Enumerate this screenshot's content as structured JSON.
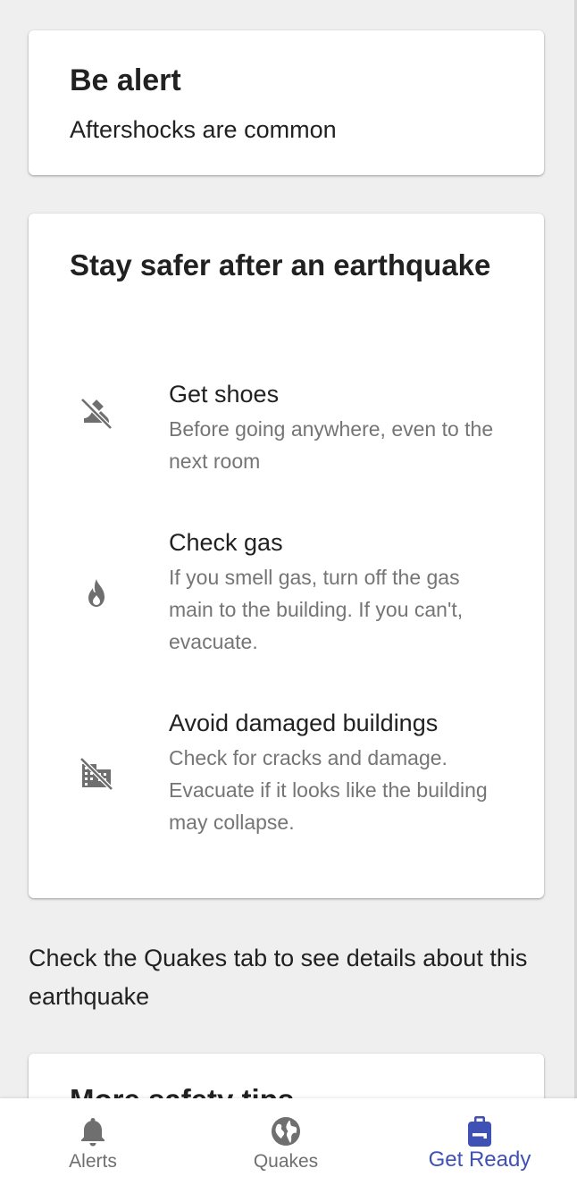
{
  "alert_card": {
    "title": "Be alert",
    "subtitle": "Aftershocks are common"
  },
  "safety_card": {
    "title": "Stay safer after an earthquake",
    "tips": [
      {
        "icon": "no-shoes-icon",
        "title": "Get shoes",
        "description": "Before going anywhere, even to the next room"
      },
      {
        "icon": "fire-icon",
        "title": "Check gas",
        "description": "If you smell gas, turn off the gas main to the building. If you can't, evacuate."
      },
      {
        "icon": "no-building-icon",
        "title": "Avoid damaged buildings",
        "description": "Check for cracks and damage. Evacuate if it looks like the building may collapse."
      }
    ]
  },
  "info_text": "Check the Quakes tab to see details about this earthquake",
  "more_card": {
    "title": "More safety tips"
  },
  "bottom_nav": {
    "items": [
      {
        "label": "Alerts",
        "icon": "bell-icon",
        "active": false
      },
      {
        "label": "Quakes",
        "icon": "globe-icon",
        "active": false
      },
      {
        "label": "Get Ready",
        "icon": "backpack-icon",
        "active": true
      }
    ]
  },
  "colors": {
    "background": "#efefef",
    "card": "#ffffff",
    "primary_text": "#212121",
    "secondary_text": "#757575",
    "icon_gray": "#6f6f6f",
    "accent": "#3f51b5"
  }
}
